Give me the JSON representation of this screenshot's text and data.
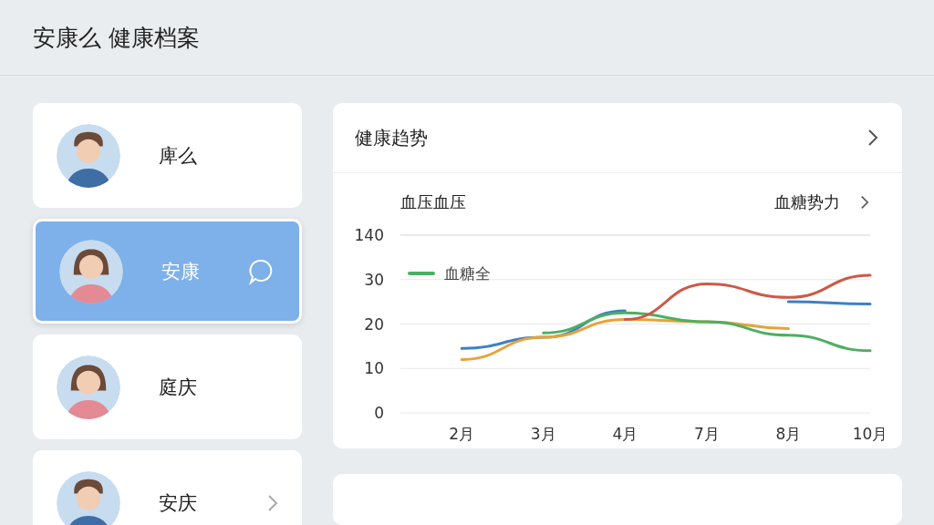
{
  "header": {
    "title": "安康么 健康档案"
  },
  "sidebar": {
    "items": [
      {
        "name": "庳么",
        "selected": false,
        "avatar": {
          "kind": "man"
        }
      },
      {
        "name": "安康",
        "selected": true,
        "avatar": {
          "kind": "woman"
        },
        "accessory": {
          "kind": "chat"
        }
      },
      {
        "name": "庭庆",
        "selected": false,
        "avatar": {
          "kind": "woman"
        }
      },
      {
        "name": "安庆",
        "selected": false,
        "avatar": {
          "kind": "man"
        },
        "accessory": {
          "kind": "chevron"
        }
      }
    ]
  },
  "trend_card": {
    "title": "健康趋势",
    "subtitle_left": "血压血压",
    "subtitle_right": "血糖势力",
    "y_axis_top_label": "140",
    "chart_data": {
      "type": "line",
      "categories": [
        "2月",
        "3月",
        "4月",
        "7月",
        "8月",
        "10月"
      ],
      "ylim": [
        0,
        40
      ],
      "yticks": [
        0,
        10,
        20,
        30
      ],
      "grid": true,
      "series": [
        {
          "color": "#3d7fc8",
          "values": [
            14.5,
            17,
            23,
            null,
            25,
            24.5
          ]
        },
        {
          "color": "#e8a23a",
          "values": [
            12,
            17,
            21,
            20.5,
            19,
            null
          ]
        },
        {
          "name": "血糖全",
          "color": "#4caf62",
          "values": [
            null,
            18,
            22.5,
            20.5,
            17.5,
            14
          ]
        },
        {
          "color": "#cc5a48",
          "values": [
            null,
            null,
            21,
            29,
            26,
            31
          ]
        }
      ]
    }
  },
  "lower_card": {
    "kind": "card"
  }
}
